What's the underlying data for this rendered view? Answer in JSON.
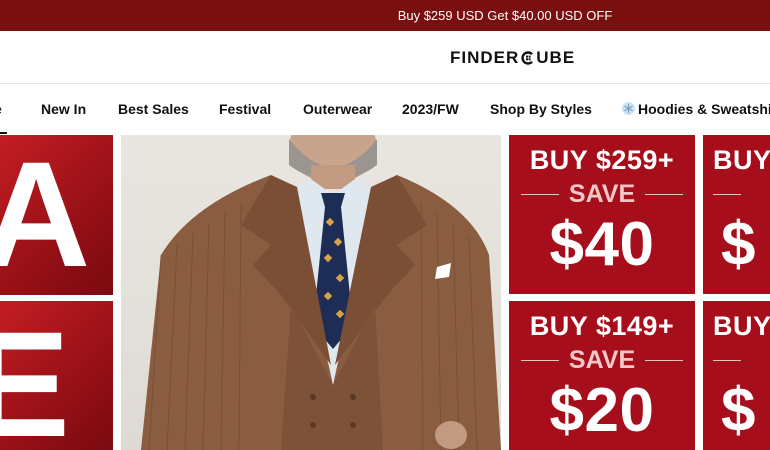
{
  "promo": {
    "text": "Buy $259 USD Get $40.00 USD OFF"
  },
  "header": {
    "logo_text_left": "FINDER",
    "logo_text_right": "UBE",
    "logo_icon": "cube-logo-icon"
  },
  "nav": {
    "items": [
      {
        "label": "e"
      },
      {
        "label": "New In"
      },
      {
        "label": "Best Sales"
      },
      {
        "label": "Festival"
      },
      {
        "label": "Outerwear"
      },
      {
        "label": "2023/FW"
      },
      {
        "label": "Shop By Styles"
      },
      {
        "label": "Hoodies & Sweatshir",
        "icon": "snowflake-icon"
      }
    ]
  },
  "hero": {
    "sale_letters": [
      "A",
      "E"
    ],
    "coupons": [
      {
        "buy": "BUY $259+",
        "save": "SAVE",
        "amount": "$40"
      },
      {
        "buy": "BUY",
        "save": "",
        "amount": "$"
      },
      {
        "buy": "BUY $149+",
        "save": "SAVE",
        "amount": "$20"
      },
      {
        "buy": "BUY",
        "save": "",
        "amount": "$"
      }
    ]
  },
  "colors": {
    "promo_bg": "#7a0f0f",
    "coupon_bg": "#a50e1a",
    "sale_red": "#c41d24"
  }
}
